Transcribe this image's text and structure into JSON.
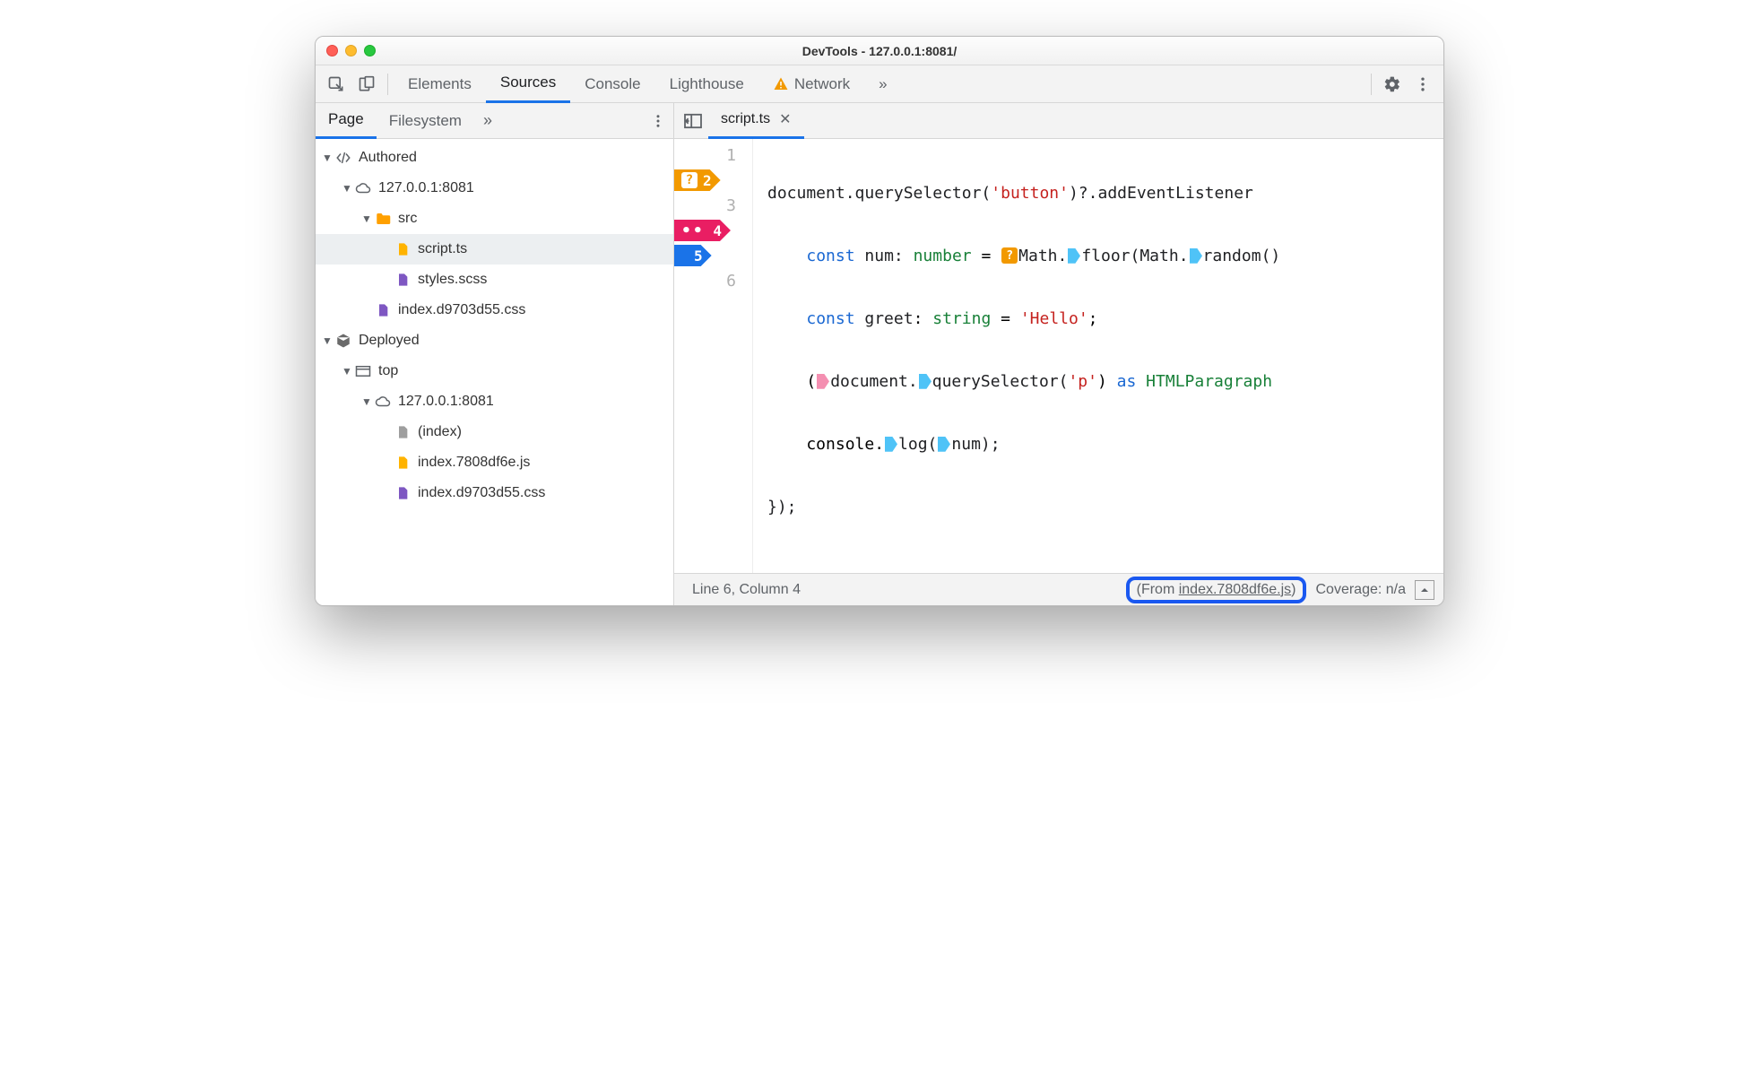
{
  "window": {
    "title": "DevTools - 127.0.0.1:8081/"
  },
  "topTabs": {
    "items": [
      {
        "label": "Elements"
      },
      {
        "label": "Sources",
        "active": true
      },
      {
        "label": "Console"
      },
      {
        "label": "Lighthouse"
      },
      {
        "label": "Network",
        "warn": true
      }
    ],
    "overflow": "»"
  },
  "sidebar": {
    "tabs": {
      "page": "Page",
      "filesystem": "Filesystem",
      "overflow": "»"
    },
    "tree": {
      "authored": "Authored",
      "host1": "127.0.0.1:8081",
      "src": "src",
      "scriptts": "script.ts",
      "stylesscss": "styles.scss",
      "indexcss1": "index.d9703d55.css",
      "deployed": "Deployed",
      "top": "top",
      "host2": "127.0.0.1:8081",
      "index": "(index)",
      "indexjs": "index.7808df6e.js",
      "indexcss2": "index.d9703d55.css"
    }
  },
  "editor": {
    "openFile": "script.ts",
    "lineNumbers": [
      "1",
      "2",
      "3",
      "4",
      "5",
      "6"
    ],
    "bp2": "2",
    "bp4": "4",
    "bp5": "5",
    "code": {
      "l1_a": "document",
      "l1_b": ".querySelector(",
      "l1_c": "'button'",
      "l1_d": ")?.addEventListener",
      "l2_a": "    ",
      "l2_const": "const",
      "l2_sp": " ",
      "l2_num": "num",
      "l2_colon": ": ",
      "l2_type": "number",
      "l2_eq": " = ",
      "l2_math": "Math.",
      "l2_floor": "floor(Math.",
      "l2_rand": "random()",
      "l3_a": "    ",
      "l3_const": "const",
      "l3_greet": " greet",
      "l3_colon": ": ",
      "l3_type": "string",
      "l3_eq": " = ",
      "l3_str": "'Hello'",
      "l3_semi": ";",
      "l4_a": "    (",
      "l4_doc": "document.",
      "l4_qs": "querySelector(",
      "l4_p": "'p'",
      "l4_close": ") ",
      "l4_as": "as",
      "l4_type": " HTMLParagraph",
      "l5_a": "    console.",
      "l5_log": "log(",
      "l5_num": "num);",
      "l6": "});"
    }
  },
  "status": {
    "cursor": "Line 6, Column 4",
    "from_prefix": "(From ",
    "from_link": "index.7808df6e.js",
    "from_suffix": ")",
    "coverage": "Coverage: n/a"
  }
}
